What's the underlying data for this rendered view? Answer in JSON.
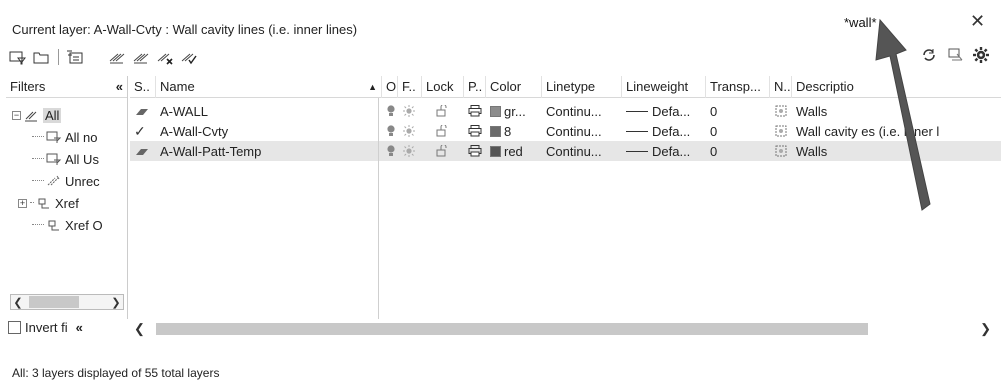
{
  "header": {
    "current_layer": "Current layer: A-Wall-Cvty : Wall cavity lines (i.e. inner lines)",
    "search_value": "*wall*",
    "close_label": "✕"
  },
  "filters": {
    "title": "Filters",
    "collapse": "«",
    "tree": [
      {
        "label": "All",
        "expander": "−"
      },
      {
        "label": "All no"
      },
      {
        "label": "All Us"
      },
      {
        "label": "Unrec"
      },
      {
        "label": "Xref",
        "expander": "+"
      },
      {
        "label": "Xref O"
      }
    ],
    "invert_label": "Invert fi",
    "invert_collapse": "«"
  },
  "columns": {
    "s": "S..",
    "name": "Name",
    "o": "O..",
    "f": "F..",
    "lock": "Lock",
    "p": "P..",
    "color": "Color",
    "linetype": "Linetype",
    "lineweight": "Lineweight",
    "transparency": "Transp...",
    "n": "N..",
    "description": "Descriptio"
  },
  "rows": [
    {
      "status": "",
      "name": "A-WALL",
      "color_name": "gr...",
      "color_hex": "#8c8c8c",
      "linetype": "Continu...",
      "lineweight": "Defa...",
      "transparency": "0",
      "description": "Walls"
    },
    {
      "status": "✓",
      "name": "A-Wall-Cvty",
      "color_name": "8",
      "color_hex": "#6b6b6b",
      "linetype": "Continu...",
      "lineweight": "Defa...",
      "transparency": "0",
      "description": "Wall cavity  es (i.e. inner l"
    },
    {
      "status": "",
      "name": "A-Wall-Patt-Temp",
      "color_name": "red",
      "color_hex": "#555555",
      "linetype": "Continu...",
      "lineweight": "Defa...",
      "transparency": "0",
      "description": "Walls"
    }
  ],
  "status_bar": "All: 3 layers displayed of 55 total layers",
  "colors": {
    "selected_row": "#e6e6e6",
    "arrow": "#555555"
  }
}
